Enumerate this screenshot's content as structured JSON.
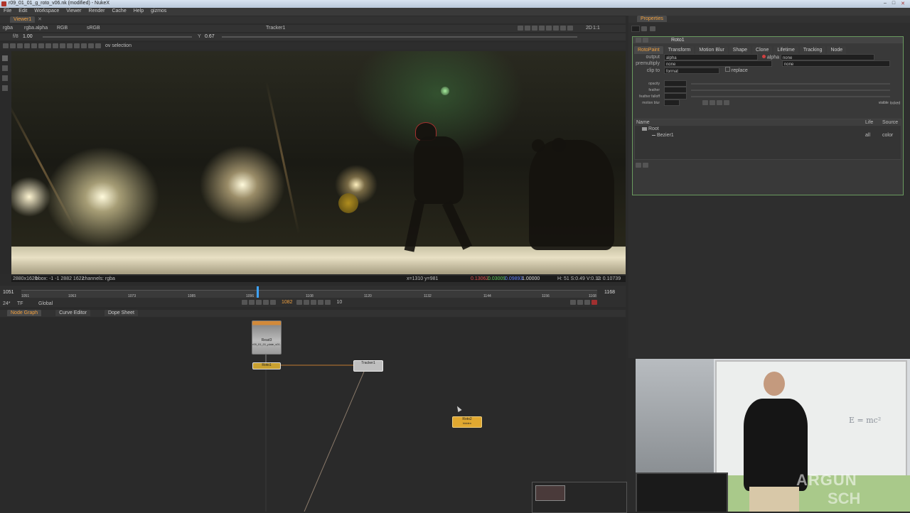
{
  "window": {
    "title": "r09_01_01_g_roto_v06.nk (modified) - NukeX"
  },
  "menu": [
    "File",
    "Edit",
    "Workspace",
    "Viewer",
    "Render",
    "Cache",
    "Help",
    "gizmos"
  ],
  "viewer_tab": "Viewer1",
  "viewer_toolbar": {
    "channels": "rgba",
    "layer": "rgba.alpha",
    "colorspace": "RGB",
    "lut": "sRGB",
    "input_b": "Tracker1",
    "gain_label": "f/8",
    "gain_value": "1.00",
    "gamma_label": "Y",
    "gamma_value": "0.67",
    "frame_label": "2D",
    "zoom_label": "1:1",
    "proxy": "ov selection"
  },
  "viewer_info": {
    "format": "2880x1620",
    "bbox": "bbox: -1 -1 2882 1622",
    "channels": "channels: rgba",
    "pos": "x=1310 y=981",
    "values": [
      "0.13062",
      "0.03009",
      "0.09893",
      "1.00000"
    ],
    "hsv": "H: 51 S:0.49 V:0.13",
    "luma": "L: 0.10739"
  },
  "timeline": {
    "start": "1051",
    "end": "1168",
    "current": "1082",
    "ticks": [
      "1051",
      "1063",
      "1073",
      "1085",
      "1096",
      "1108",
      "1120",
      "1132",
      "1144",
      "1156",
      "1168"
    ],
    "fps": "24*",
    "tf": "TF",
    "range": "Global",
    "increment": "10"
  },
  "graph_tabs": [
    "Node Graph",
    "Curve Editor",
    "Dope Sheet"
  ],
  "nodes": {
    "read": {
      "label": "Read3",
      "sub": "r09_01_01_plate_v01.exr"
    },
    "roto": {
      "label": "Roto1"
    },
    "tracker": {
      "label": "Tracker1"
    },
    "blur": {
      "label": "Roto2",
      "sub": "hidden"
    }
  },
  "properties": {
    "title": "Properties",
    "node_name": "Roto1",
    "tabs": [
      "RotoPaint",
      "Transform",
      "Motion Blur",
      "Shape",
      "Clone",
      "Lifetime",
      "Tracking",
      "Node"
    ],
    "output_label": "output",
    "output_value": "alpha",
    "premult_label": "premultiply",
    "premult_value": "none",
    "clip_label": "clip to",
    "clip_value": "format",
    "replace_label": "replace",
    "alpha_label": "alpha",
    "alpha_value": "none",
    "none2": "none",
    "opacity_label": "opacity",
    "feather_label": "feather",
    "feather_falloff_label": "feather falloff",
    "motion_blur_label": "motion blur",
    "visible_label": "visible",
    "locked_label": "locked",
    "list_header": {
      "name": "Name",
      "life": "Life",
      "source": "Source"
    },
    "list_items": [
      {
        "name": "Root",
        "life": "",
        "source": ""
      },
      {
        "name": "Bezier1",
        "life": "all",
        "source": "color"
      }
    ]
  },
  "webcam": {
    "logo": "ARGUN",
    "logo2": "SCH",
    "board": "E = mc²"
  }
}
